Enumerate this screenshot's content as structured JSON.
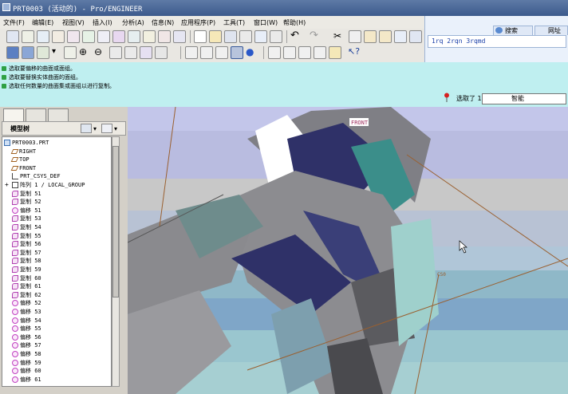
{
  "window": {
    "title": "PRT0003 (活动的) - Pro/ENGINEER"
  },
  "menu": [
    "文件(F)",
    "编辑(E)",
    "视图(V)",
    "插入(I)",
    "分析(A)",
    "信息(N)",
    "应用程序(P)",
    "工具(T)",
    "窗口(W)",
    "帮助(H)"
  ],
  "search": {
    "tab1": "搜索",
    "tab2": "网址",
    "command_text": "1rq 2rqn 3rqmd"
  },
  "messages": [
    "选取要偏移的曲面或面组。",
    "选取要替换实体曲面的面组。",
    "选取任何数量的曲面集或面组以进行复制。"
  ],
  "selection": {
    "status": "选取了 1 项",
    "filter": "智能"
  },
  "panel": {
    "title": "模型树"
  },
  "tree": [
    {
      "label": "PRT0003.PRT",
      "icon": "part-icon"
    },
    {
      "label": "RIGHT",
      "icon": "datum-plane-icon"
    },
    {
      "label": "TOP",
      "icon": "datum-plane-icon"
    },
    {
      "label": "FRONT",
      "icon": "datum-plane-icon"
    },
    {
      "label": "PRT_CSYS_DEF",
      "icon": "csys-icon"
    },
    {
      "label": "阵列 1 / LOCAL_GROUP",
      "icon": "group-icon"
    },
    {
      "label": "复制 51",
      "icon": "copy-icon"
    },
    {
      "label": "复制 52",
      "icon": "copy-icon"
    },
    {
      "label": "偏移 51",
      "icon": "offset-icon"
    },
    {
      "label": "复制 53",
      "icon": "copy-icon"
    },
    {
      "label": "复制 54",
      "icon": "copy-icon"
    },
    {
      "label": "复制 55",
      "icon": "copy-icon"
    },
    {
      "label": "复制 56",
      "icon": "copy-icon"
    },
    {
      "label": "复制 57",
      "icon": "copy-icon"
    },
    {
      "label": "复制 58",
      "icon": "copy-icon"
    },
    {
      "label": "复制 59",
      "icon": "copy-icon"
    },
    {
      "label": "复制 60",
      "icon": "copy-icon"
    },
    {
      "label": "复制 61",
      "icon": "copy-icon"
    },
    {
      "label": "复制 62",
      "icon": "copy-icon"
    },
    {
      "label": "偏移 52",
      "icon": "offset-icon"
    },
    {
      "label": "偏移 53",
      "icon": "offset-icon"
    },
    {
      "label": "偏移 54",
      "icon": "offset-icon"
    },
    {
      "label": "偏移 55",
      "icon": "offset-icon"
    },
    {
      "label": "偏移 56",
      "icon": "offset-icon"
    },
    {
      "label": "偏移 57",
      "icon": "offset-icon"
    },
    {
      "label": "偏移 58",
      "icon": "offset-icon"
    },
    {
      "label": "偏移 59",
      "icon": "offset-icon"
    },
    {
      "label": "偏移 60",
      "icon": "offset-icon"
    },
    {
      "label": "偏移 61",
      "icon": "offset-icon"
    }
  ],
  "viewport": {
    "datum_label": "FRONT",
    "datum_label_2": "CS0"
  },
  "colors": {
    "status_bg": "#bfeff0",
    "title_bg": "#3c5a8c",
    "viewport_bg": "#c3c6ea"
  }
}
